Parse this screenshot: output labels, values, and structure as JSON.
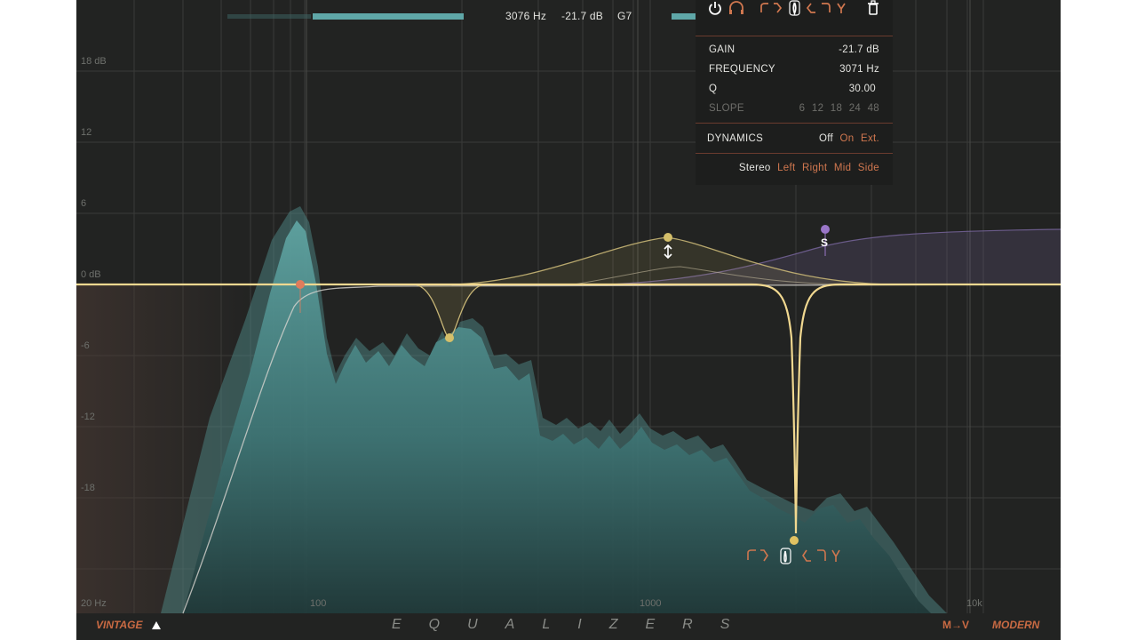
{
  "readout": {
    "freq": "3076 Hz",
    "gain": "-21.7 dB",
    "note": "G7"
  },
  "panel": {
    "gain_label": "GAIN",
    "gain_value": "-21.7 dB",
    "freq_label": "FREQUENCY",
    "freq_value": "3071 Hz",
    "q_label": "Q",
    "q_value": "30.00",
    "slope_label": "SLOPE",
    "slope_options": [
      "6",
      "12",
      "18",
      "24",
      "48"
    ],
    "dynamics_label": "DYNAMICS",
    "dynamics_options": [
      "Off",
      "On",
      "Ext."
    ],
    "stereo_label": "Stereo",
    "stereo_options": [
      "Left",
      "Right",
      "Mid",
      "Side"
    ]
  },
  "toolbar_icons": [
    "power-icon",
    "headphones-icon",
    "low-cut-icon",
    "low-shelf-icon",
    "bell-icon",
    "high-shelf-icon",
    "high-cut-icon",
    "notch-icon",
    "trash-icon"
  ],
  "y_axis": [
    "18 dB",
    "12",
    "6",
    "0 dB",
    "-6",
    "-12",
    "-18"
  ],
  "x_axis": [
    "20 Hz",
    "100",
    "1000",
    "10k"
  ],
  "band_marker": "S",
  "bottom": {
    "left": "VINTAGE",
    "title": "EQUALIZERS",
    "mode": "M→V",
    "right": "MODERN"
  },
  "colors": {
    "background": "#222322",
    "eq_curve": "#f1d890",
    "spectrum": "#4f8a89",
    "accent": "#d0774f",
    "side_band": "#8b6bb4"
  }
}
